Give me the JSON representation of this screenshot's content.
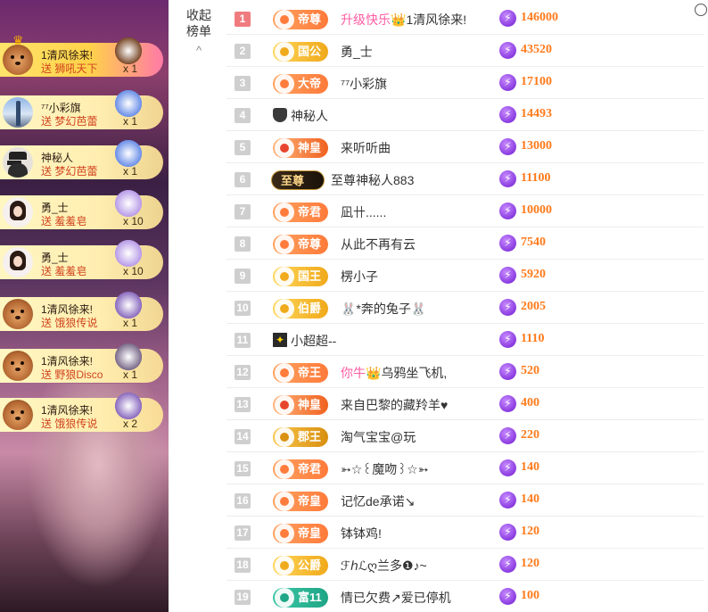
{
  "collapse": {
    "line1": "收起",
    "line2": "榜单",
    "chevron": "^"
  },
  "gift_feed": [
    {
      "user": "1清风徐来!",
      "prefix": "送",
      "gift": "狮吼天下",
      "count": "x 1",
      "avatar": "dog",
      "first": true
    },
    {
      "user": "⁷⁷小彩旗",
      "prefix": "送",
      "gift": "梦幻芭蕾",
      "count": "x 1",
      "avatar": "tower"
    },
    {
      "user": "神秘人",
      "prefix": "送",
      "gift": "梦幻芭蕾",
      "count": "x 1",
      "avatar": "spy"
    },
    {
      "user": "勇_士",
      "prefix": "送",
      "gift": "羞羞皂",
      "count": "x 10",
      "avatar": "girl"
    },
    {
      "user": "勇_士",
      "prefix": "送",
      "gift": "羞羞皂",
      "count": "x 10",
      "avatar": "girl"
    },
    {
      "user": "1清风徐来!",
      "prefix": "送",
      "gift": "饿狼传说",
      "count": "x 1",
      "avatar": "dog"
    },
    {
      "user": "1清风徐来!",
      "prefix": "送",
      "gift": "野狼Disco",
      "count": "x 1",
      "avatar": "dog"
    },
    {
      "user": "1清风徐来!",
      "prefix": "送",
      "gift": "饿狼传说",
      "count": "x 2",
      "avatar": "dog"
    }
  ],
  "chart_data": {
    "type": "table",
    "columns": [
      "rank",
      "badge",
      "name",
      "value"
    ],
    "rows": [
      {
        "rank": "1",
        "badge": "帝尊",
        "badge_style": "orange",
        "name": "升级快乐👑1清风徐来!",
        "name_pink": "升级快乐👑",
        "name_tail": "1清风徐来!",
        "value": 146000
      },
      {
        "rank": "2",
        "badge": "国公",
        "badge_style": "gold",
        "name": "勇_士",
        "value": 43520
      },
      {
        "rank": "3",
        "badge": "大帝",
        "badge_style": "orange",
        "name": "⁷⁷小彩旗",
        "value": 17100
      },
      {
        "rank": "4",
        "badge": "",
        "badge_style": "spy",
        "name": "神秘人",
        "value": 14493
      },
      {
        "rank": "5",
        "badge": "神皇",
        "badge_style": "red",
        "name": "来听听曲",
        "value": 13000
      },
      {
        "rank": "6",
        "badge": "至尊",
        "badge_style": "black",
        "name": "至尊神秘人883",
        "value": 11100
      },
      {
        "rank": "7",
        "badge": "帝君",
        "badge_style": "orange",
        "name": "凪卄......",
        "value": 10000
      },
      {
        "rank": "8",
        "badge": "帝尊",
        "badge_style": "orange",
        "name": "从此不再有云",
        "value": 7540
      },
      {
        "rank": "9",
        "badge": "国王",
        "badge_style": "gold",
        "name": "楞小子",
        "value": 5920
      },
      {
        "rank": "10",
        "badge": "伯爵",
        "badge_style": "gold",
        "name": "🐰*奔的兔子🐰",
        "value": 2005
      },
      {
        "rank": "11",
        "badge": "",
        "badge_style": "star",
        "name": "小超超--",
        "value": 1110
      },
      {
        "rank": "12",
        "badge": "帝王",
        "badge_style": "orange",
        "name": "你牛👑乌鸦坐飞机,",
        "name_pink": "你牛👑",
        "name_tail": "乌鸦坐飞机,",
        "value": 520
      },
      {
        "rank": "13",
        "badge": "神皇",
        "badge_style": "red",
        "name": "来自巴黎的藏羚羊♥",
        "value": 400
      },
      {
        "rank": "14",
        "badge": "郡王",
        "badge_style": "darkgold",
        "name": "淘气宝宝@玩",
        "value": 220
      },
      {
        "rank": "15",
        "badge": "帝君",
        "badge_style": "orange",
        "name": "➳☆꒰魔吻꒱☆➳",
        "value": 140
      },
      {
        "rank": "16",
        "badge": "帝皇",
        "badge_style": "orange",
        "name": "记忆de承诺↘",
        "value": 140
      },
      {
        "rank": "17",
        "badge": "帝皇",
        "badge_style": "orange",
        "name": "钵钵鸡!",
        "value": 120
      },
      {
        "rank": "18",
        "badge": "公爵",
        "badge_style": "gold",
        "name": "ℱℎℒღ兰多❶♪~",
        "value": 120
      },
      {
        "rank": "19",
        "badge": "富11",
        "badge_style": "teal",
        "name": "情已欠费↗爱已停机",
        "value": 100
      }
    ],
    "currency_icon": "lightning-coin-icon",
    "colors": {
      "value": "#ff7a1a",
      "rank_top": "#f07b7f",
      "rank": "#cfcfcf",
      "name_highlight": "#ff5ba3"
    }
  }
}
